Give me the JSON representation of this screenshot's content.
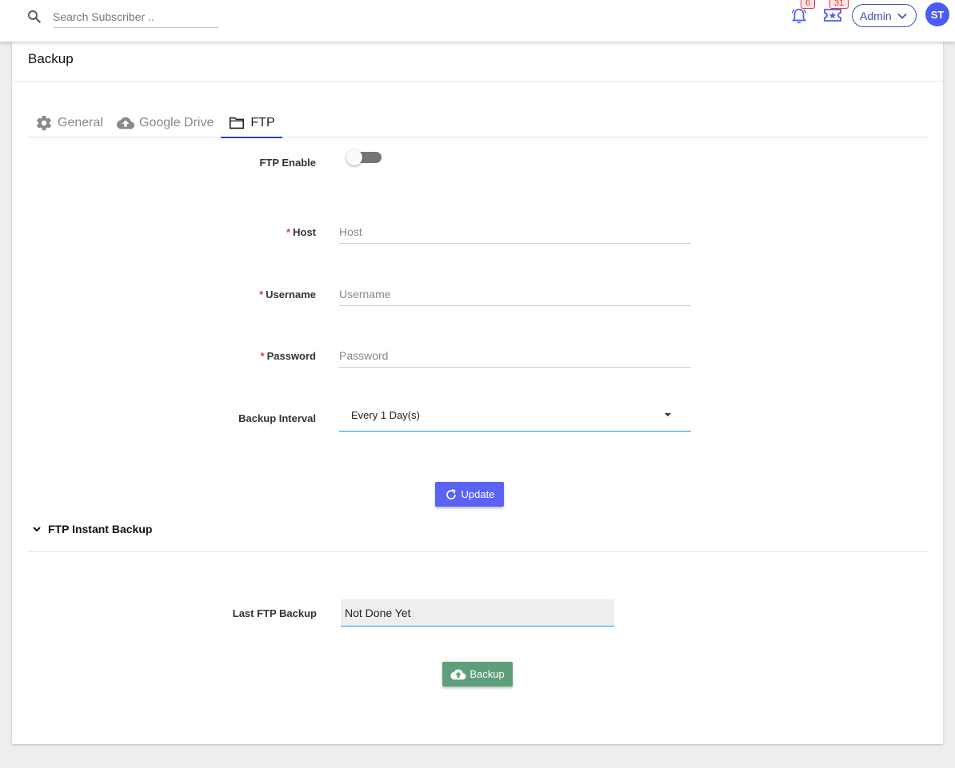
{
  "topbar": {
    "search_placeholder": "Search Subscriber ..",
    "notifications_count": "6",
    "tickets_count": "31",
    "user_menu_label": "Admin",
    "avatar_initials": "ST"
  },
  "page": {
    "title": "Backup"
  },
  "tabs": [
    {
      "label": "General",
      "icon": "gear-icon",
      "active": false
    },
    {
      "label": "Google Drive",
      "icon": "cloud-icon",
      "active": false
    },
    {
      "label": "FTP",
      "icon": "folder-icon",
      "active": true
    }
  ],
  "ftp_form": {
    "enable_label": "FTP Enable",
    "enable_value": false,
    "required_mark": "*",
    "host_label": "Host",
    "host_placeholder": "Host",
    "username_label": "Username",
    "username_placeholder": "Username",
    "password_label": "Password",
    "password_placeholder": "Password",
    "interval_label": "Backup Interval",
    "interval_value": "Every 1 Day(s)",
    "update_button": "Update"
  },
  "instant_backup": {
    "section_title": "FTP Instant Backup",
    "last_backup_label": "Last FTP Backup",
    "last_backup_value": "Not Done Yet",
    "backup_button": "Backup"
  },
  "colors": {
    "primary": "#5b63f5",
    "success": "#5e9e7b",
    "badge": "#e53935",
    "focus_underline": "#2196f3"
  }
}
